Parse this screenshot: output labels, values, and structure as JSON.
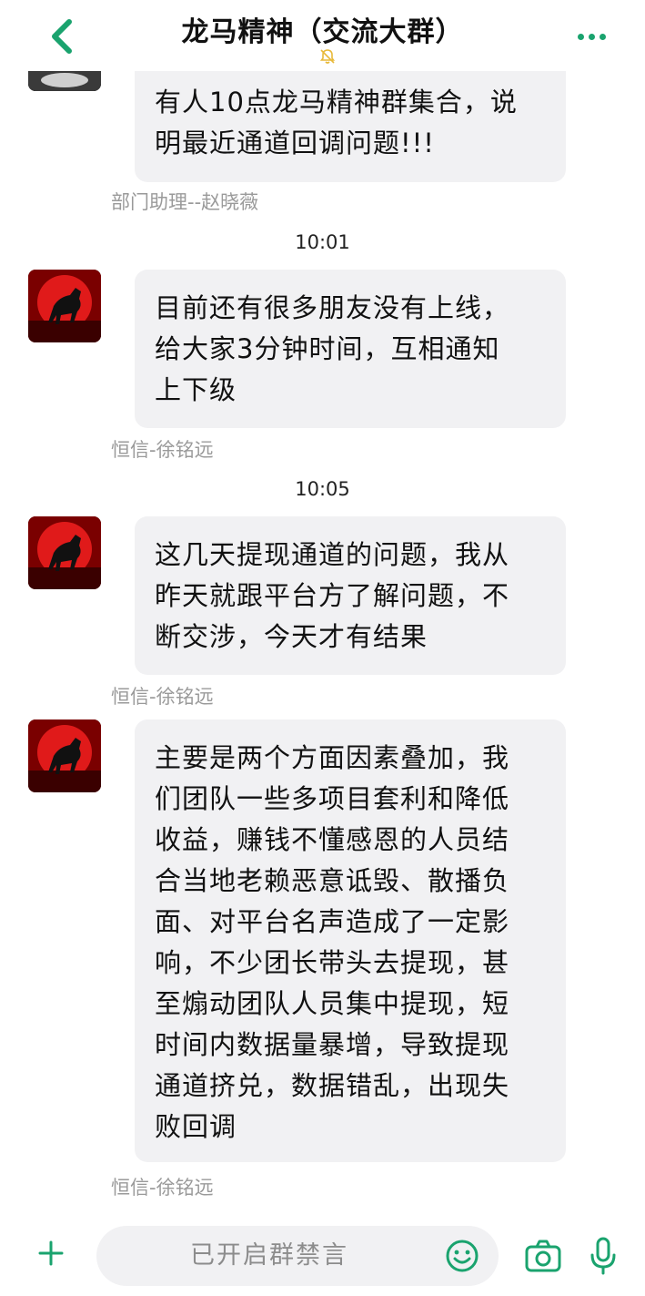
{
  "header": {
    "title": "龙马精神（交流大群）",
    "back_icon": "chevron-left-icon",
    "mute_icon": "bell-off-icon",
    "more_icon": "more-dots-icon",
    "accent_color": "#1aa36e"
  },
  "messages": [
    {
      "text": "有人10点龙马精神群集合，说明最近通道回调问题!!!",
      "lines": [
        "有人10点龙马精神群集合，说",
        "明最近通道回调问题!!!"
      ],
      "sender": "部门助理--赵晓薇"
    },
    {
      "time": "10:01",
      "text": "目前还有很多朋友没有上线，给大家3分钟时间，互相通知上下级",
      "lines": [
        "目前还有很多朋友没有上线，",
        "给大家3分钟时间，互相通知",
        "上下级"
      ],
      "sender": "恒信-徐铭远"
    },
    {
      "time": "10:05",
      "text": "这几天提现通道的问题，我从昨天就跟平台方了解问题，不断交涉，今天才有结果",
      "lines": [
        "这几天提现通道的问题，我从",
        "昨天就跟平台方了解问题，不",
        "断交涉，今天才有结果"
      ],
      "sender": "恒信-徐铭远"
    },
    {
      "text": "主要是两个方面因素叠加，我们团队一些多项目套利和降低收益，赚钱不懂感恩的人员结合当地老赖恶意诋毁、散播负面、对平台名声造成了一定影响，不少团长带头去提现，甚至煽动团队人员集中提现，短时间内数据量暴增，导致提现通道挤兑，数据错乱，出现失败回调",
      "lines": [
        "主要是两个方面因素叠加，我",
        "们团队一些多项目套利和降低",
        "收益，赚钱不懂感恩的人员结",
        "合当地老赖恶意诋毁、散播负",
        "面、对平台名声造成了一定影",
        "响，不少团长带头去提现，甚",
        "至煽动团队人员集中提现，短",
        "时间内数据量暴增，导致提现",
        "通道挤兑，数据错乱，出现失",
        "败回调"
      ],
      "sender": "恒信-徐铭远"
    }
  ],
  "input_bar": {
    "placeholder": "已开启群禁言",
    "plus_icon": "plus-icon",
    "emoji_icon": "smiley-icon",
    "camera_icon": "camera-icon",
    "mic_icon": "microphone-icon"
  }
}
